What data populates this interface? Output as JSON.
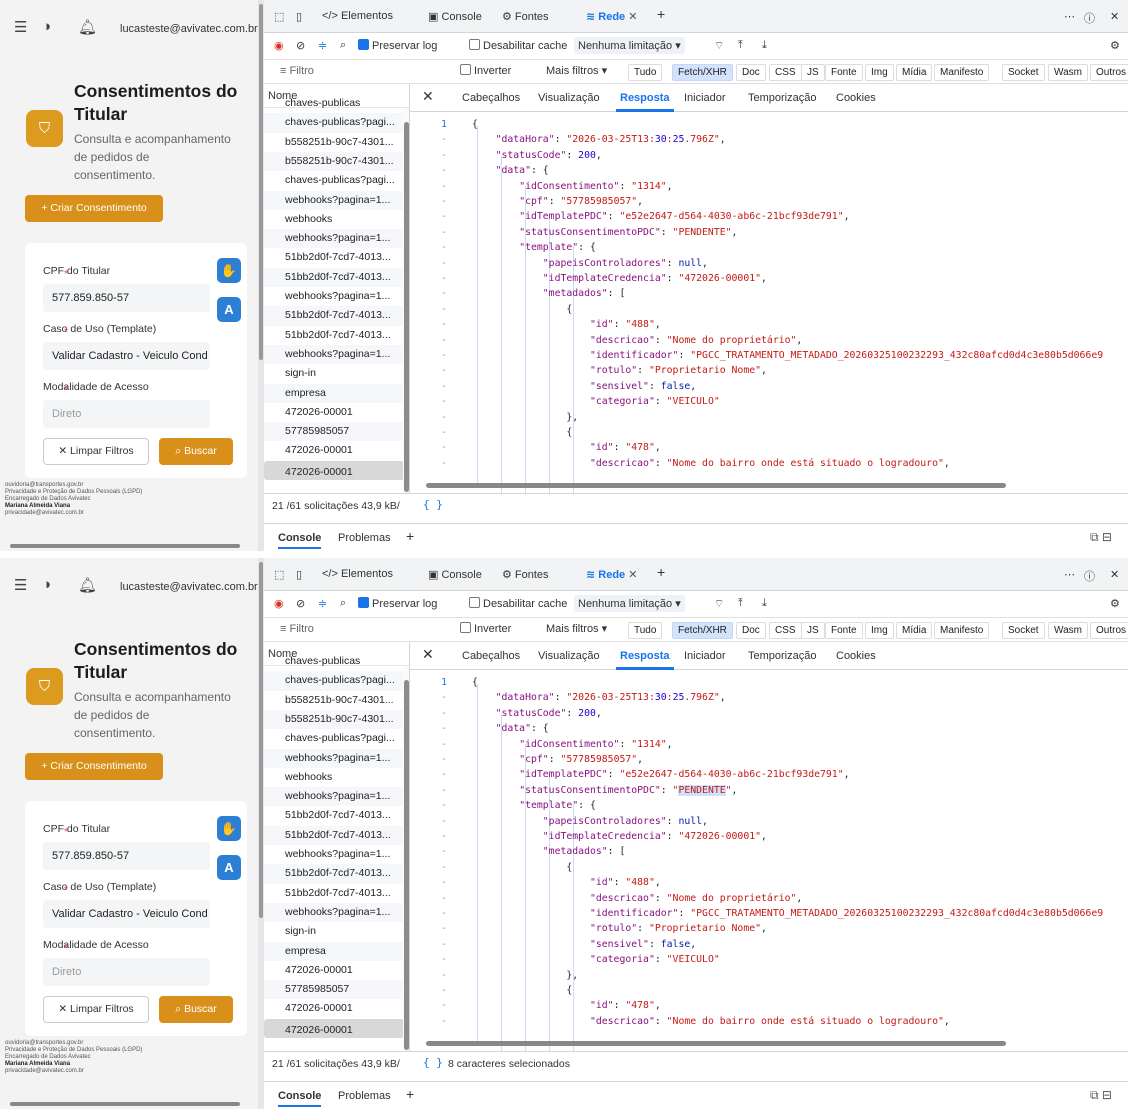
{
  "screens": [
    {
      "app": {
        "email": "lucasteste@avivatec.com.br",
        "title": "Consentimentos do Titular",
        "subtitle": "Consulta e acompanhamento de pedidos de consentimento.",
        "create_button": "+ Criar Consentimento",
        "cpf_label": "CPF do Titular",
        "cpf_value": "577.859.850-57",
        "usecase_label": "Caso de Uso (Template)",
        "usecase_value": "Validar Cadastro - Veiculo Cond",
        "modality_label": "Modalidade de Acesso",
        "modality_placeholder": "Direto",
        "clear_button": "✕ Limpar Filtros",
        "search_button": "Buscar",
        "fab_label": "A",
        "footer_lines": [
          "ouvidoria@transportes.gov.br",
          "Privacidade e Proteção de Dados Pessoais (LGPD)",
          "Encarregado de Dados Avivatec",
          "Mariana Almeida Viana",
          "privacidade@avivatec.com.br"
        ]
      },
      "devtools": {
        "tabs": [
          "Elementos",
          "Console",
          "Fontes",
          "Rede"
        ],
        "toolbar": {
          "preserve_log": "Preservar log",
          "disable_cache": "Desabilitar cache",
          "throttle": "Nenhuma limitação"
        },
        "filter_placeholder": "Filtro",
        "invert": "Inverter",
        "more_filters": "Mais filtros ▾",
        "type_filters": [
          "Tudo",
          "Fetch/XHR",
          "Doc",
          "CSS",
          "JS",
          "Fonte",
          "Img",
          "Mídia",
          "Manifesto",
          "Socket",
          "Wasm",
          "Outros"
        ],
        "list_header": "Nome",
        "requests": [
          "chaves-publicas",
          "chaves-publicas?pagi...",
          "b558251b-90c7-4301...",
          "b558251b-90c7-4301...",
          "chaves-publicas?pagi...",
          "webhooks?pagina=1...",
          "webhooks",
          "webhooks?pagina=1...",
          "51bb2d0f-7cd7-4013...",
          "51bb2d0f-7cd7-4013...",
          "webhooks?pagina=1...",
          "51bb2d0f-7cd7-4013...",
          "51bb2d0f-7cd7-4013...",
          "webhooks?pagina=1...",
          "sign-in",
          "empresa",
          "472026-00001",
          "57785985057",
          "472026-00001",
          "472026-00001"
        ],
        "detail_tabs": [
          "Cabeçalhos",
          "Visualização",
          "Resposta",
          "Iniciador",
          "Temporização",
          "Cookies"
        ],
        "status": "21 /61 solicitações  43,9 kB/",
        "status_selection": "",
        "drawer_tabs": [
          "Console",
          "Problemas"
        ],
        "code_lines": [
          "{",
          "    \"dataHora\": \"2026-03-25T13:30:25.796Z\",",
          "    \"statusCode\": 200,",
          "    \"data\": {",
          "        \"idConsentimento\": \"1314\",",
          "        \"cpf\": \"57785985057\",",
          "        \"idTemplatePDC\": \"e52e2647-d564-4030-ab6c-21bcf93de791\",",
          "        \"statusConsentimentoPDC\": \"PENDENTE\",",
          "        \"template\": {",
          "            \"papeisControladores\": null,",
          "            \"idTemplateCredencia\": \"472026-00001\",",
          "            \"metadados\": [",
          "                {",
          "                    \"id\": \"488\",",
          "                    \"descricao\": \"Nome do proprietário\",",
          "                    \"identificador\": \"PGCC_TRATAMENTO_METADADO_20260325100232293_432c80afcd0d4c3e80b5d066e9",
          "                    \"rotulo\": \"Proprietario Nome\",",
          "                    \"sensivel\": false,",
          "                    \"categoria\": \"VEICULO\"",
          "                },",
          "                {",
          "                    \"id\": \"478\",",
          "                    \"descricao\": \"Nome do bairro onde está situado o logradouro\","
        ]
      }
    },
    {
      "app": {
        "email": "lucasteste@avivatec.com.br",
        "title": "Consentimentos do Titular",
        "subtitle": "Consulta e acompanhamento de pedidos de consentimento.",
        "create_button": "+ Criar Consentimento",
        "cpf_label": "CPF do Titular",
        "cpf_value": "577.859.850-57",
        "usecase_label": "Caso de Uso (Template)",
        "usecase_value": "Validar Cadastro - Veiculo Cond",
        "modality_label": "Modalidade de Acesso",
        "modality_placeholder": "Direto",
        "clear_button": "✕ Limpar Filtros",
        "search_button": "Buscar",
        "fab_label": "A",
        "footer_lines": [
          "ouvidoria@transportes.gov.br",
          "Privacidade e Proteção de Dados Pessoais (LGPD)",
          "Encarregado de Dados Avivatec",
          "Mariana Almeida Viana",
          "privacidade@avivatec.com.br"
        ]
      },
      "devtools": {
        "tabs": [
          "Elementos",
          "Console",
          "Fontes",
          "Rede"
        ],
        "toolbar": {
          "preserve_log": "Preservar log",
          "disable_cache": "Desabilitar cache",
          "throttle": "Nenhuma limitação"
        },
        "filter_placeholder": "Filtro",
        "invert": "Inverter",
        "more_filters": "Mais filtros ▾",
        "type_filters": [
          "Tudo",
          "Fetch/XHR",
          "Doc",
          "CSS",
          "JS",
          "Fonte",
          "Img",
          "Mídia",
          "Manifesto",
          "Socket",
          "Wasm",
          "Outros"
        ],
        "list_header": "Nome",
        "requests": [
          "chaves-publicas",
          "chaves-publicas?pagi...",
          "b558251b-90c7-4301...",
          "b558251b-90c7-4301...",
          "chaves-publicas?pagi...",
          "webhooks?pagina=1...",
          "webhooks",
          "webhooks?pagina=1...",
          "51bb2d0f-7cd7-4013...",
          "51bb2d0f-7cd7-4013...",
          "webhooks?pagina=1...",
          "51bb2d0f-7cd7-4013...",
          "51bb2d0f-7cd7-4013...",
          "webhooks?pagina=1...",
          "sign-in",
          "empresa",
          "472026-00001",
          "57785985057",
          "472026-00001",
          "472026-00001"
        ],
        "detail_tabs": [
          "Cabeçalhos",
          "Visualização",
          "Resposta",
          "Iniciador",
          "Temporização",
          "Cookies"
        ],
        "status": "21 /61 solicitações  43,9 kB/",
        "status_selection": "8 caracteres selecionados",
        "drawer_tabs": [
          "Console",
          "Problemas"
        ],
        "code_lines": [
          "{",
          "    \"dataHora\": \"2026-03-25T13:30:25.796Z\",",
          "    \"statusCode\": 200,",
          "    \"data\": {",
          "        \"idConsentimento\": \"1314\",",
          "        \"cpf\": \"57785985057\",",
          "        \"idTemplatePDC\": \"e52e2647-d564-4030-ab6c-21bcf93de791\",",
          "        \"statusConsentimentoPDC\": \"PENDENTE\",",
          "        \"template\": {",
          "            \"papeisControladores\": null,",
          "            \"idTemplateCredencia\": \"472026-00001\",",
          "            \"metadados\": [",
          "                {",
          "                    \"id\": \"488\",",
          "                    \"descricao\": \"Nome do proprietário\",",
          "                    \"identificador\": \"PGCC_TRATAMENTO_METADADO_20260325100232293_432c80afcd0d4c3e80b5d066e9",
          "                    \"rotulo\": \"Proprietario Nome\",",
          "                    \"sensivel\": false,",
          "                    \"categoria\": \"VEICULO\"",
          "                },",
          "                {",
          "                    \"id\": \"478\",",
          "                    \"descricao\": \"Nome do bairro onde está situado o logradouro\","
        ]
      }
    }
  ]
}
